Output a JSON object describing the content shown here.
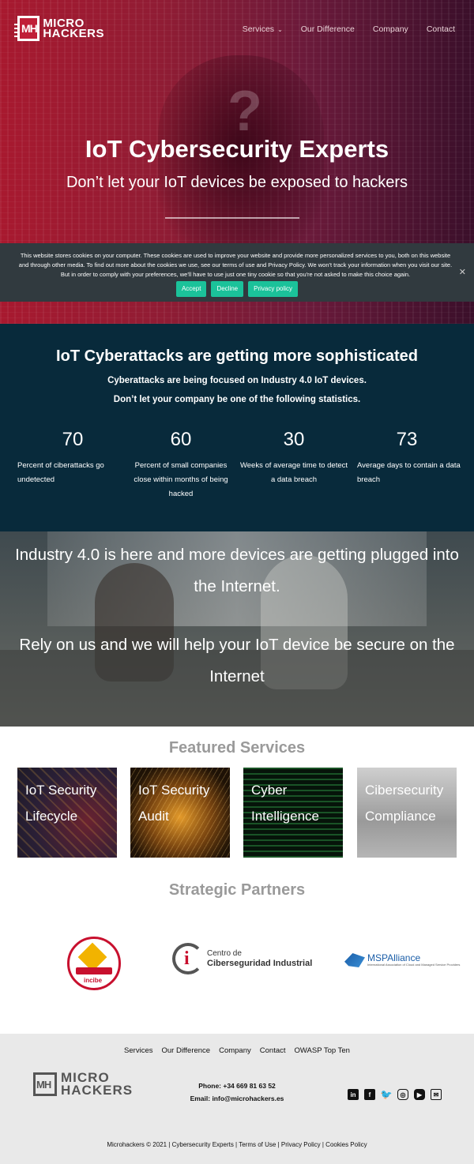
{
  "header": {
    "logo_line1": "MICRO",
    "logo_line2": "HACKERS",
    "nav": [
      "Services",
      "Our Difference",
      "Company",
      "Contact"
    ]
  },
  "hero": {
    "title": "IoT Cybersecurity Experts",
    "subtitle": "Don’t let your IoT devices be exposed to hackers"
  },
  "cookie": {
    "text": "This website stores cookies on your computer. These cookies are used to improve your website and provide more personalized services to you, both on this website and through other media. To find out more about the cookies we use, see our terms of use and Privacy Policy. We won't track your information when you visit our site. But in order to comply with your preferences, we'll have to use just one tiny cookie so that you're not asked to make this choice again.",
    "accept": "Accept",
    "decline": "Decline",
    "privacy": "Privacy policy"
  },
  "stats": {
    "title": "IoT Cyberattacks are getting more sophisticated",
    "line1": "Cyberattacks are being focused on Industry 4.0 IoT devices.",
    "line2": "Don’t let your company be one of the following statistics.",
    "items": [
      {
        "num": "70",
        "desc": "Percent of ciberattacks go undetected"
      },
      {
        "num": "60",
        "desc": "Percent of small companies close within months of being hacked"
      },
      {
        "num": "30",
        "desc": "Weeks of average time to detect a data breach"
      },
      {
        "num": "73",
        "desc": "Average days to contain a data breach"
      }
    ]
  },
  "industry": {
    "line1": "Industry 4.0 is here and more devices are getting plugged into the Internet.",
    "line2": "Rely on us and we will help your IoT device be secure on the Internet"
  },
  "featured": {
    "title": "Featured Services",
    "cards": [
      "IoT Security Lifecycle",
      "IoT Security Audit",
      "Cyber Intelligence",
      "Cibersecurity Compliance"
    ]
  },
  "partners": {
    "title": "Strategic Partners",
    "incibe": "incibe",
    "cc_line1": "Centro de",
    "cc_line2": "Ciberseguridad Industrial",
    "msp": "MSPAlliance",
    "msp_sub": "International Association of Cloud and Managed Service Providers"
  },
  "footer": {
    "nav": [
      "Services",
      "Our Difference",
      "Company",
      "Contact",
      "OWASP Top Ten"
    ],
    "phone": "Phone: +34 669 81 63 52",
    "email": "Email: info@microhackers.es",
    "copyright": "Microhackers © 2021 | Cybersecurity Experts |  Terms of Use | Privacy Policy | Cookies Policy"
  }
}
